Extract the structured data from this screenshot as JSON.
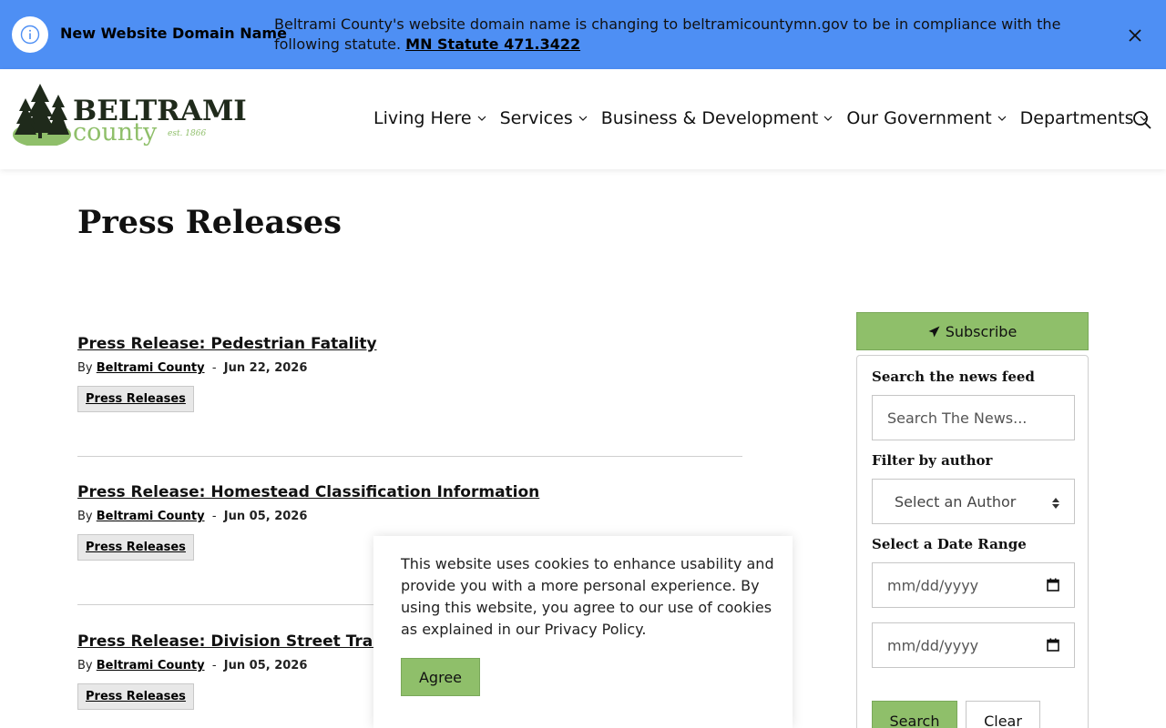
{
  "alert": {
    "title": "New Website Domain Name",
    "message": "Beltrami County's website domain name is changing to beltramicountymn.gov to be in compliance with the following statute.",
    "link_text": "MN Statute 471.3422",
    "icon": "info-icon",
    "close_icon": "close-icon"
  },
  "logo": {
    "word1": "BELTRAMI",
    "word2": "county",
    "est": "est. 1866"
  },
  "nav": {
    "items": [
      {
        "label": "Living Here"
      },
      {
        "label": "Services"
      },
      {
        "label": "Business & Development"
      },
      {
        "label": "Our Government"
      },
      {
        "label": "Departments"
      }
    ],
    "search_icon": "search-icon"
  },
  "page": {
    "title": "Press Releases"
  },
  "articles": [
    {
      "title": "Press Release: Pedestrian Fatality",
      "by": "By",
      "author": "Beltrami County",
      "sep": "-",
      "date": "Jun 22, 2026",
      "tag": "Press Releases"
    },
    {
      "title": "Press Release: Homestead Classification Information",
      "by": "By",
      "author": "Beltrami County",
      "sep": "-",
      "date": "Jun 05, 2026",
      "tag": "Press Releases"
    },
    {
      "title": "Press Release: Division Street Trail C",
      "by": "By",
      "author": "Beltrami County",
      "sep": "-",
      "date": "Jun 05, 2026",
      "tag": "Press Releases"
    }
  ],
  "sidebar": {
    "subscribe_label": "Subscribe",
    "search_label": "Search the news feed",
    "search_placeholder": "Search The News...",
    "author_label": "Filter by author",
    "author_value": "Select an Author",
    "date_label": "Select a Date Range",
    "date_from": "mm/dd/yyyy",
    "date_to": "mm/dd/yyyy",
    "search_button": "Search",
    "clear_button": "Clear"
  },
  "cookie": {
    "text": "This website uses cookies to enhance usability and provide you with a more personal experience. By using this website, you agree to our use of cookies as explained in our Privacy Policy.",
    "agree": "Agree"
  },
  "colors": {
    "banner": "#4e8ff4",
    "accent_green": "#8fbf6a"
  }
}
